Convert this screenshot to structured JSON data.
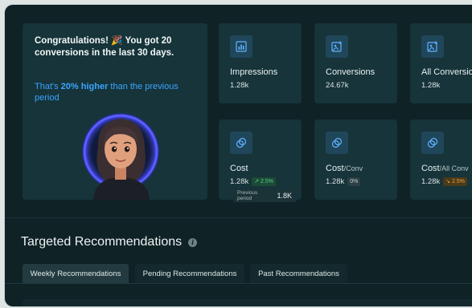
{
  "hero": {
    "message": "Congratulations! 🎉 You got 20 conversions in the last 30 days.",
    "sub_prefix": "That's ",
    "sub_highlight": "20% higher",
    "sub_suffix": " than the previous period"
  },
  "metrics": [
    {
      "label": "Impressions",
      "value": "1.28k",
      "icon": "bar-chart-icon"
    },
    {
      "label": "Conversions",
      "value": "24.67k",
      "icon": "image-plus-icon"
    },
    {
      "label": "All Conversions",
      "value": "1.28k",
      "icon": "image-plus-icon"
    },
    {
      "label": "Cost",
      "label_small": "",
      "value": "1.28k",
      "badge": "↗ 2.5%",
      "badge_type": "up",
      "icon": "coins-icon"
    },
    {
      "label": "Cost",
      "label_small": "/Conv",
      "value": "1.28k",
      "badge": "0%",
      "badge_type": "flat",
      "icon": "coins-icon"
    },
    {
      "label": "Cost",
      "label_small": "/All Conv",
      "value": "1.28k",
      "badge": "↘ 2.5%",
      "badge_type": "down",
      "icon": "coins-icon"
    }
  ],
  "tooltip": {
    "label": "Previous period",
    "value": "1.8K"
  },
  "recommendations": {
    "title": "Targeted Recommendations",
    "tabs": [
      "Weekly Recommendations",
      "Pending Recommendations",
      "Past Recommendations"
    ],
    "active_tab": 0
  },
  "colors": {
    "accent": "#3ba5ff",
    "background": "#0f2226",
    "card": "#16343a",
    "up": "#52d08a",
    "down": "#f0a33a"
  }
}
